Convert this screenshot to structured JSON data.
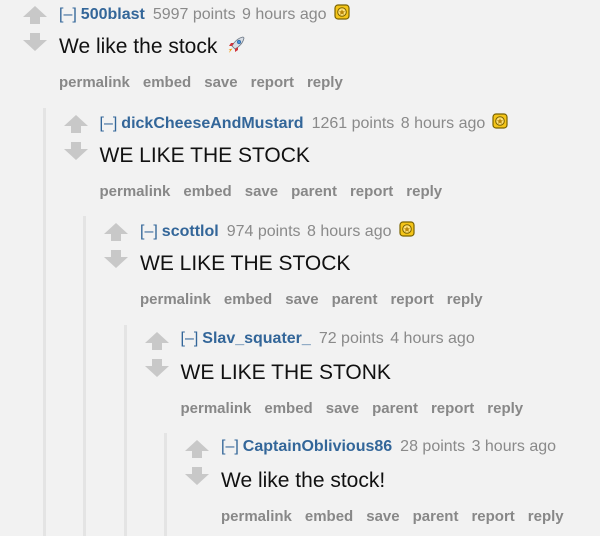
{
  "toggle_label": "[–]",
  "comments": [
    {
      "author": "500blast",
      "points": "5997 points",
      "time": "9 hours ago",
      "has_award": true,
      "text": "We like the stock",
      "has_rocket": true,
      "buttons": [
        "permalink",
        "embed",
        "save",
        "report",
        "reply"
      ]
    },
    {
      "author": "dickCheeseAndMustard",
      "points": "1261 points",
      "time": "8 hours ago",
      "has_award": true,
      "text": "WE LIKE THE STOCK",
      "has_rocket": false,
      "buttons": [
        "permalink",
        "embed",
        "save",
        "parent",
        "report",
        "reply"
      ]
    },
    {
      "author": "scottlol",
      "points": "974 points",
      "time": "8 hours ago",
      "has_award": true,
      "text": "WE LIKE THE STOCK",
      "has_rocket": false,
      "buttons": [
        "permalink",
        "embed",
        "save",
        "parent",
        "report",
        "reply"
      ]
    },
    {
      "author": "Slav_squater_",
      "points": "72 points",
      "time": "4 hours ago",
      "has_award": false,
      "text": "WE LIKE THE STONK",
      "has_rocket": false,
      "buttons": [
        "permalink",
        "embed",
        "save",
        "parent",
        "report",
        "reply"
      ]
    },
    {
      "author": "CaptainOblivious86",
      "points": "28 points",
      "time": "3 hours ago",
      "has_award": false,
      "text": "We like the stock!",
      "has_rocket": false,
      "buttons": [
        "permalink",
        "embed",
        "save",
        "parent",
        "report",
        "reply"
      ]
    }
  ],
  "colors": {
    "background": "#f2f2f2",
    "link": "#336699",
    "meta": "#8a8a8a",
    "arrow": "#c8c8c8",
    "thread_line": "#e4e4e4",
    "award_gold": "#f5c518"
  },
  "icons": {
    "upvote": "up-arrow-icon",
    "downvote": "down-arrow-icon",
    "award": "gold-award-icon",
    "rocket": "rocket-emoji-icon"
  }
}
